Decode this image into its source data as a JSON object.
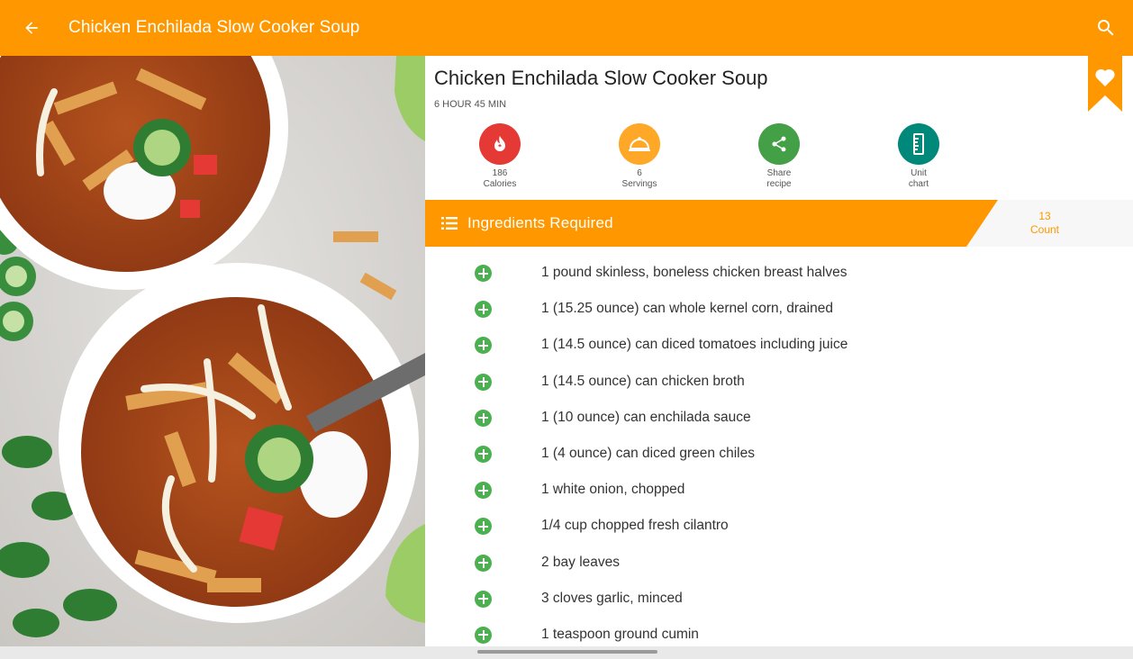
{
  "appbar": {
    "title": "Chicken Enchilada Slow Cooker Soup",
    "back_icon": "arrow-left-icon",
    "search_icon": "search-icon",
    "color": "#ff9800"
  },
  "recipe": {
    "title": "Chicken Enchilada Slow Cooker Soup",
    "time": "6 HOUR 45 MIN",
    "bookmark_icon": "heart-bookmark-icon"
  },
  "stats": [
    {
      "line1": "186",
      "line2": "Calories",
      "icon": "calories-icon",
      "color": "#e53935"
    },
    {
      "line1": "6",
      "line2": "Servings",
      "icon": "serving-dish-icon",
      "color": "#ffa726"
    },
    {
      "line1": "Share",
      "line2": "recipe",
      "icon": "share-icon",
      "color": "#43a047"
    },
    {
      "line1": "Unit",
      "line2": "chart",
      "icon": "ruler-icon",
      "color": "#00897b"
    }
  ],
  "ingredients": {
    "header": "Ingredients Required",
    "count_value": "13",
    "count_label": "Count",
    "items": [
      "1 pound skinless, boneless chicken breast halves",
      "1 (15.25 ounce) can whole kernel corn, drained",
      "1 (14.5 ounce) can diced tomatoes including juice",
      "1 (14.5 ounce) can chicken broth",
      "1 (10 ounce) can enchilada sauce",
      "1 (4 ounce) can diced green chiles",
      "1 white onion, chopped",
      "1/4 cup chopped fresh cilantro",
      "2 bay leaves",
      "3 cloves garlic, minced",
      "1 teaspoon ground cumin"
    ]
  }
}
